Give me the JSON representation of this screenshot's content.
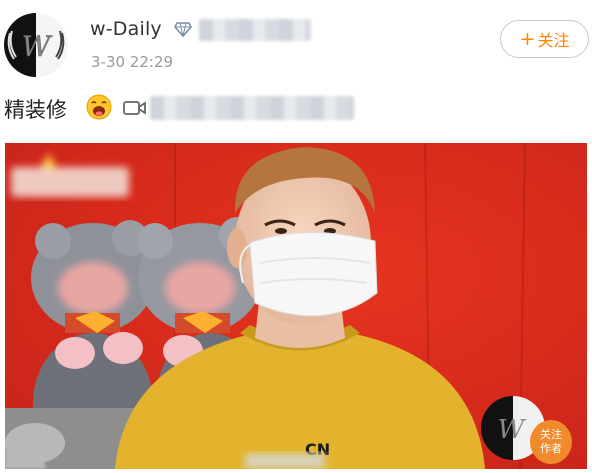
{
  "post": {
    "author": {
      "name": "w-Daily",
      "avatar_letter": "W"
    },
    "timestamp": "3-30 22:29",
    "follow_label": "关注",
    "follow_plus": "+",
    "text": "精装修"
  },
  "photo": {
    "badge": {
      "text": "关注\n作者",
      "line1": "关注",
      "line2": "作者"
    },
    "shirt_text": "CN"
  },
  "colors": {
    "accent": "#ff8200",
    "photo_background": "#d82a1c",
    "shirt": "#e3b32d",
    "follow_badge": "#f08a2a"
  },
  "icons": [
    "vip-diamond-icon",
    "laughing-emoji-icon",
    "video-link-icon"
  ]
}
